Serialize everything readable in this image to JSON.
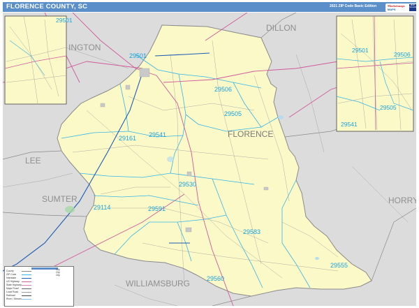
{
  "header": {
    "title": "FLORENCE COUNTY, SC",
    "edition": "2021 ZIP Code Basic Edition"
  },
  "logo": {
    "line1": "Marketmaps",
    "line2": "MAPS",
    "badge": "MAP SALES"
  },
  "colors": {
    "title_bar": "#5b8fc9",
    "county_fill": "#fbf9c8",
    "outside_fill": "#dcdcdc",
    "zip_boundary": "#35b4e6",
    "zip_label": "#1aa3dc",
    "county_boundary": "#8a8a8a",
    "highway": "#d15a9a",
    "interstate": "#1e5bb5",
    "road": "#9a9a9a"
  },
  "counties": [
    {
      "id": "dillon",
      "label": "DILLON"
    },
    {
      "id": "darlington",
      "label": "INGTON"
    },
    {
      "id": "florence",
      "label": "FLORENCE"
    },
    {
      "id": "lee",
      "label": "LEE"
    },
    {
      "id": "sumter",
      "label": "SUMTER"
    },
    {
      "id": "horry",
      "label": "HORRY"
    },
    {
      "id": "williamsburg",
      "label": "WILLIAMSBURG"
    }
  ],
  "zips": [
    {
      "id": "29501",
      "label": "29501"
    },
    {
      "id": "29506",
      "label": "29506"
    },
    {
      "id": "29505",
      "label": "29505"
    },
    {
      "id": "29541",
      "label": "29541"
    },
    {
      "id": "29161",
      "label": "29161"
    },
    {
      "id": "29530",
      "label": "29530"
    },
    {
      "id": "29114",
      "label": "29114"
    },
    {
      "id": "29591",
      "label": "29591"
    },
    {
      "id": "29583",
      "label": "29583"
    },
    {
      "id": "29555",
      "label": "29555"
    },
    {
      "id": "29560",
      "label": "29560"
    }
  ],
  "insets": {
    "left": {
      "zip_label": "29501",
      "top_label": "29501"
    },
    "right": [
      {
        "id": "r29501",
        "label": "29501"
      },
      {
        "id": "r29506",
        "label": "29506"
      },
      {
        "id": "r29505",
        "label": "29505"
      },
      {
        "id": "r29541",
        "label": "29541"
      }
    ]
  },
  "legend": {
    "rows": [
      {
        "label": "County",
        "note": ""
      },
      {
        "label": "ZIP Code",
        "note": ""
      },
      {
        "label": "Interstate",
        "note": ""
      },
      {
        "label": "US Highway",
        "note": ""
      },
      {
        "label": "State Highway",
        "note": ""
      },
      {
        "label": "Major Road",
        "note": ""
      },
      {
        "label": "Local Road",
        "note": ""
      },
      {
        "label": "Railroad",
        "note": ""
      },
      {
        "label": "River / Stream",
        "note": ""
      }
    ],
    "scale_labels": [
      "City",
      "City",
      "City"
    ]
  }
}
